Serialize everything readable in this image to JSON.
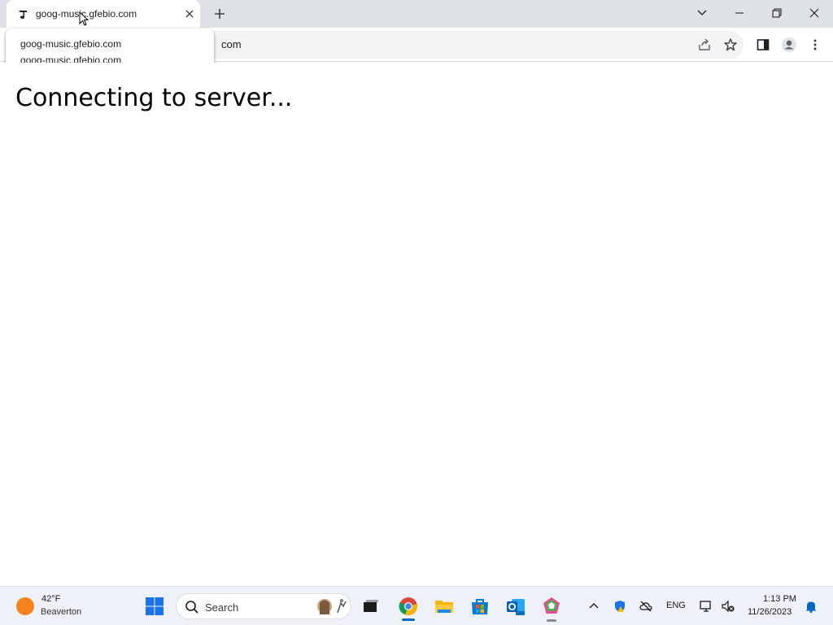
{
  "browser": {
    "tab": {
      "title": "goog-music.gfebio.com",
      "favicon": "music-note-icon"
    },
    "tooltip": {
      "line1": "goog-music.gfebio.com",
      "line2": "goog-music.gfebio.com"
    },
    "address_bar": {
      "visible_url_fragment": "com"
    },
    "icons": {
      "share": "share-icon",
      "bookmark": "star-icon",
      "side_panel": "side-panel-icon",
      "profile": "profile-icon",
      "menu": "kebab-menu-icon"
    }
  },
  "page": {
    "heading": "Connecting to server..."
  },
  "taskbar": {
    "weather": {
      "temperature": "42°F",
      "location": "Beaverton"
    },
    "search_placeholder": "Search",
    "language": "ENG",
    "clock": {
      "time": "1:13 PM",
      "date": "11/26/2023"
    },
    "accent_color": "#0067c0"
  }
}
